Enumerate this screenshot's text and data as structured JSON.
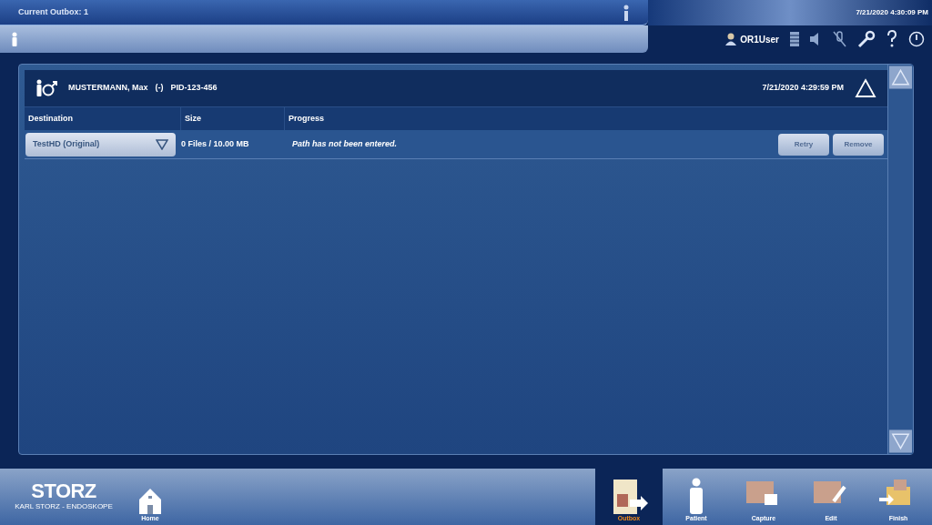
{
  "header": {
    "title": "Current Outbox: 1",
    "datetime": "7/21/2020  4:30:09 PM",
    "user": "OR1User"
  },
  "patient": {
    "name": "MUSTERMANN, Max",
    "sex": "(-)",
    "pid": "PID-123-456",
    "datetime": "7/21/2020  4:29:59 PM"
  },
  "table": {
    "columns": [
      "Destination",
      "Size",
      "Progress"
    ],
    "rows": [
      {
        "destination": "TestHD  (Original)",
        "size": "0 Files / 10.00 MB",
        "progress": "Path has not been entered.",
        "buttons": [
          "Retry",
          "Remove"
        ]
      }
    ]
  },
  "logo": {
    "text": "STORZ",
    "subtext": "KARL STORZ - ENDOSKOPE"
  },
  "nav_left": [
    {
      "label": "Home",
      "kind": "home"
    }
  ],
  "nav_right": [
    {
      "label": "Outbox",
      "kind": "outbox",
      "selected": true
    },
    {
      "label": "Patient",
      "kind": "patient",
      "selected": false
    },
    {
      "label": "Capture",
      "kind": "capture",
      "selected": false
    },
    {
      "label": "Edit",
      "kind": "edit",
      "selected": false
    },
    {
      "label": "Finish",
      "kind": "finish",
      "selected": false
    }
  ]
}
